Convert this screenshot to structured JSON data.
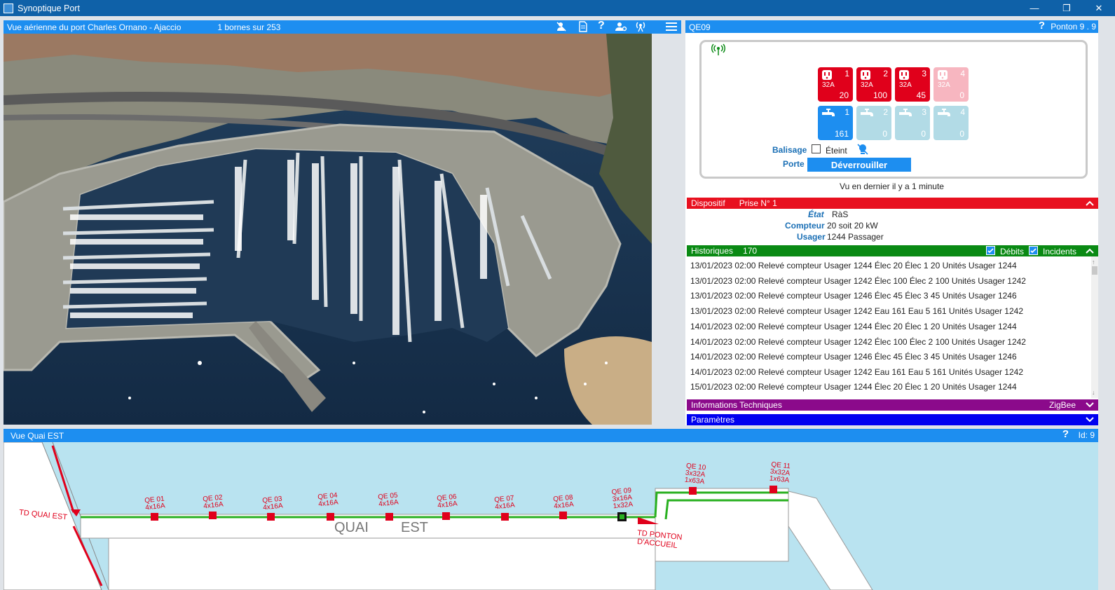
{
  "window": {
    "title": "Synoptique Port",
    "minimize": "—",
    "maximize": "❐",
    "close": "✕"
  },
  "aerial_panel": {
    "title": "Vue aérienne du port  Charles Ornano - Ajaccio",
    "count_text": "1  bornes sur  253"
  },
  "device_panel": {
    "id": "QE09",
    "help": "?",
    "ponton": "Ponton  9 . 9",
    "sockets": [
      {
        "num": "1",
        "amp": "32A",
        "value": "20",
        "active": true
      },
      {
        "num": "2",
        "amp": "32A",
        "value": "100",
        "active": true
      },
      {
        "num": "3",
        "amp": "32A",
        "value": "45",
        "active": true
      },
      {
        "num": "4",
        "amp": "32A",
        "value": "0",
        "active": false
      }
    ],
    "taps": [
      {
        "num": "1",
        "value": "161",
        "active": true
      },
      {
        "num": "2",
        "value": "0",
        "active": false
      },
      {
        "num": "3",
        "value": "0",
        "active": false
      },
      {
        "num": "4",
        "value": "0",
        "active": false
      }
    ],
    "balisage_label": "Balisage",
    "balisage_state": "Éteint",
    "porte_label": "Porte",
    "unlock_button": "Déverrouiller",
    "last_seen": "Vu en dernier il y a 1 minute"
  },
  "dispositif": {
    "title": "Dispositif",
    "prise": "Prise N°  1",
    "etat_label": "État",
    "etat_value": "RàS",
    "compteur_label": "Compteur",
    "compteur_value": "20  soit  20 kW",
    "usager_label": "Usager",
    "usager_value": "1244 Passager"
  },
  "historiques": {
    "title": "Historiques",
    "count": "170",
    "debits_label": "Débits",
    "incidents_label": "Incidents",
    "rows": [
      "13/01/2023 02:00 Relevé compteur Usager 1244  Élec 20 Élec 1  20 Unités Usager 1244",
      "13/01/2023 02:00 Relevé compteur Usager 1242  Élec 100 Élec 2  100 Unités Usager 1242",
      "13/01/2023 02:00 Relevé compteur Usager 1246  Élec 45 Élec 3  45 Unités Usager 1246",
      "13/01/2023 02:00 Relevé compteur Usager 1242  Eau 161 Eau 5  161 Unités Usager 1242",
      "14/01/2023 02:00 Relevé compteur Usager 1244  Élec 20 Élec 1  20 Unités Usager 1244",
      "14/01/2023 02:00 Relevé compteur Usager 1242  Élec 100 Élec 2  100 Unités Usager 1242",
      "14/01/2023 02:00 Relevé compteur Usager 1246  Élec 45 Élec 3  45 Unités Usager 1246",
      "14/01/2023 02:00 Relevé compteur Usager 1242  Eau 161 Eau 5  161 Unités Usager 1242",
      "15/01/2023 02:00 Relevé compteur Usager 1244  Élec 20 Élec 1  20 Unités Usager 1244"
    ]
  },
  "infos_tech": {
    "title": "Informations Techniques",
    "protocol": "ZigBee"
  },
  "parametres": {
    "title": "Paramètres"
  },
  "bottom_panel": {
    "title": "Vue  Quai EST",
    "help": "?",
    "id_text": "Id:  9",
    "td_quai": "TD QUAI EST",
    "quai_word1": "QUAI",
    "quai_word2": "EST",
    "td_ponton_1": "TD PONTON",
    "td_ponton_2": "D'ACCUEIL",
    "terminals": [
      {
        "name": "QE 01",
        "spec": "4x16A"
      },
      {
        "name": "QE 02",
        "spec": "4x16A"
      },
      {
        "name": "QE 03",
        "spec": "4x16A"
      },
      {
        "name": "QE 04",
        "spec": "4x16A"
      },
      {
        "name": "QE 05",
        "spec": "4x16A"
      },
      {
        "name": "QE 06",
        "spec": "4x16A"
      },
      {
        "name": "QE 07",
        "spec": "4x16A"
      },
      {
        "name": "QE 08",
        "spec": "4x16A"
      },
      {
        "name": "QE 09",
        "spec": "1x32A",
        "spec2": "3x16A"
      },
      {
        "name": "QE 10",
        "spec": "3x32A",
        "spec2": "1x63A"
      },
      {
        "name": "QE 11",
        "spec": "3x32A",
        "spec2": "1x63A"
      }
    ]
  },
  "colors": {
    "accent": "#1d8ef0",
    "titlebar": "#0f61a8",
    "danger": "#e0001b",
    "history": "#0a8a14",
    "tech": "#8b0a8b",
    "params": "#0000f0"
  }
}
